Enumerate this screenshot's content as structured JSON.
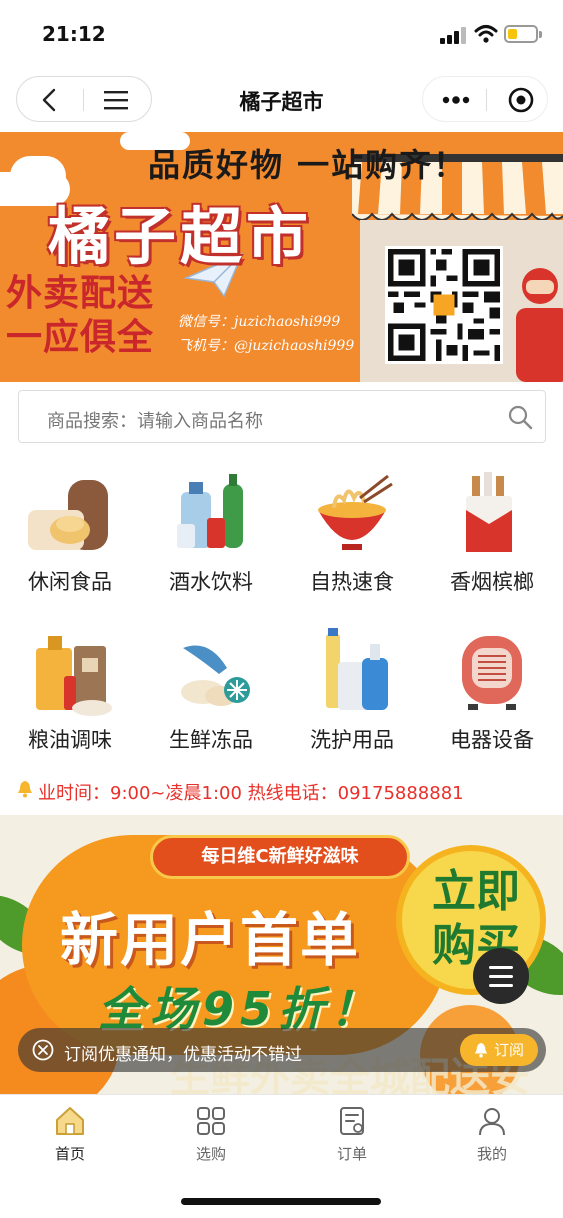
{
  "status_bar": {
    "time": "21:12",
    "battery_level": 0.35
  },
  "nav": {
    "title": "橘子超市"
  },
  "banner": {
    "slogan": "品质好物 一站购齐！",
    "store_name": "橘子超市",
    "delivery_line1": "外卖配送",
    "delivery_line2": "一应俱全",
    "wechat": "微信号：juzichaoshi999",
    "qq": "飞机号：@juzichaoshi999"
  },
  "search": {
    "placeholder": "商品搜索：请输入商品名称"
  },
  "categories": [
    {
      "label": "休闲食品",
      "icon": "snack-food-icon"
    },
    {
      "label": "酒水饮料",
      "icon": "beverage-icon"
    },
    {
      "label": "自热速食",
      "icon": "instant-noodle-icon"
    },
    {
      "label": "香烟槟榔",
      "icon": "cigarette-icon"
    },
    {
      "label": "粮油调味",
      "icon": "grain-oil-icon"
    },
    {
      "label": "生鲜冻品",
      "icon": "fresh-frozen-icon"
    },
    {
      "label": "洗护用品",
      "icon": "toiletries-icon"
    },
    {
      "label": "电器设备",
      "icon": "appliance-icon"
    }
  ],
  "notice": {
    "text": "业时间：9:00~凌晨1:00 热线电话：09175888881"
  },
  "promo": {
    "tag": "每日维C新鲜好滋味",
    "headline": "新用户首单",
    "discount": "全场95折！",
    "buy": "立即购买",
    "sub": "生鲜外卖全城配送安全保障"
  },
  "subscribe": {
    "text": "订阅优惠通知，优惠活动不错过",
    "button": "订阅"
  },
  "tabs": [
    {
      "label": "首页",
      "icon": "home-icon",
      "active": true
    },
    {
      "label": "选购",
      "icon": "grid-icon",
      "active": false
    },
    {
      "label": "订单",
      "icon": "order-icon",
      "active": false
    },
    {
      "label": "我的",
      "icon": "profile-icon",
      "active": false
    }
  ],
  "colors": {
    "brand_orange": "#f28a2e",
    "notice_red": "#e8312a",
    "promo_green": "#1f8a3a"
  }
}
